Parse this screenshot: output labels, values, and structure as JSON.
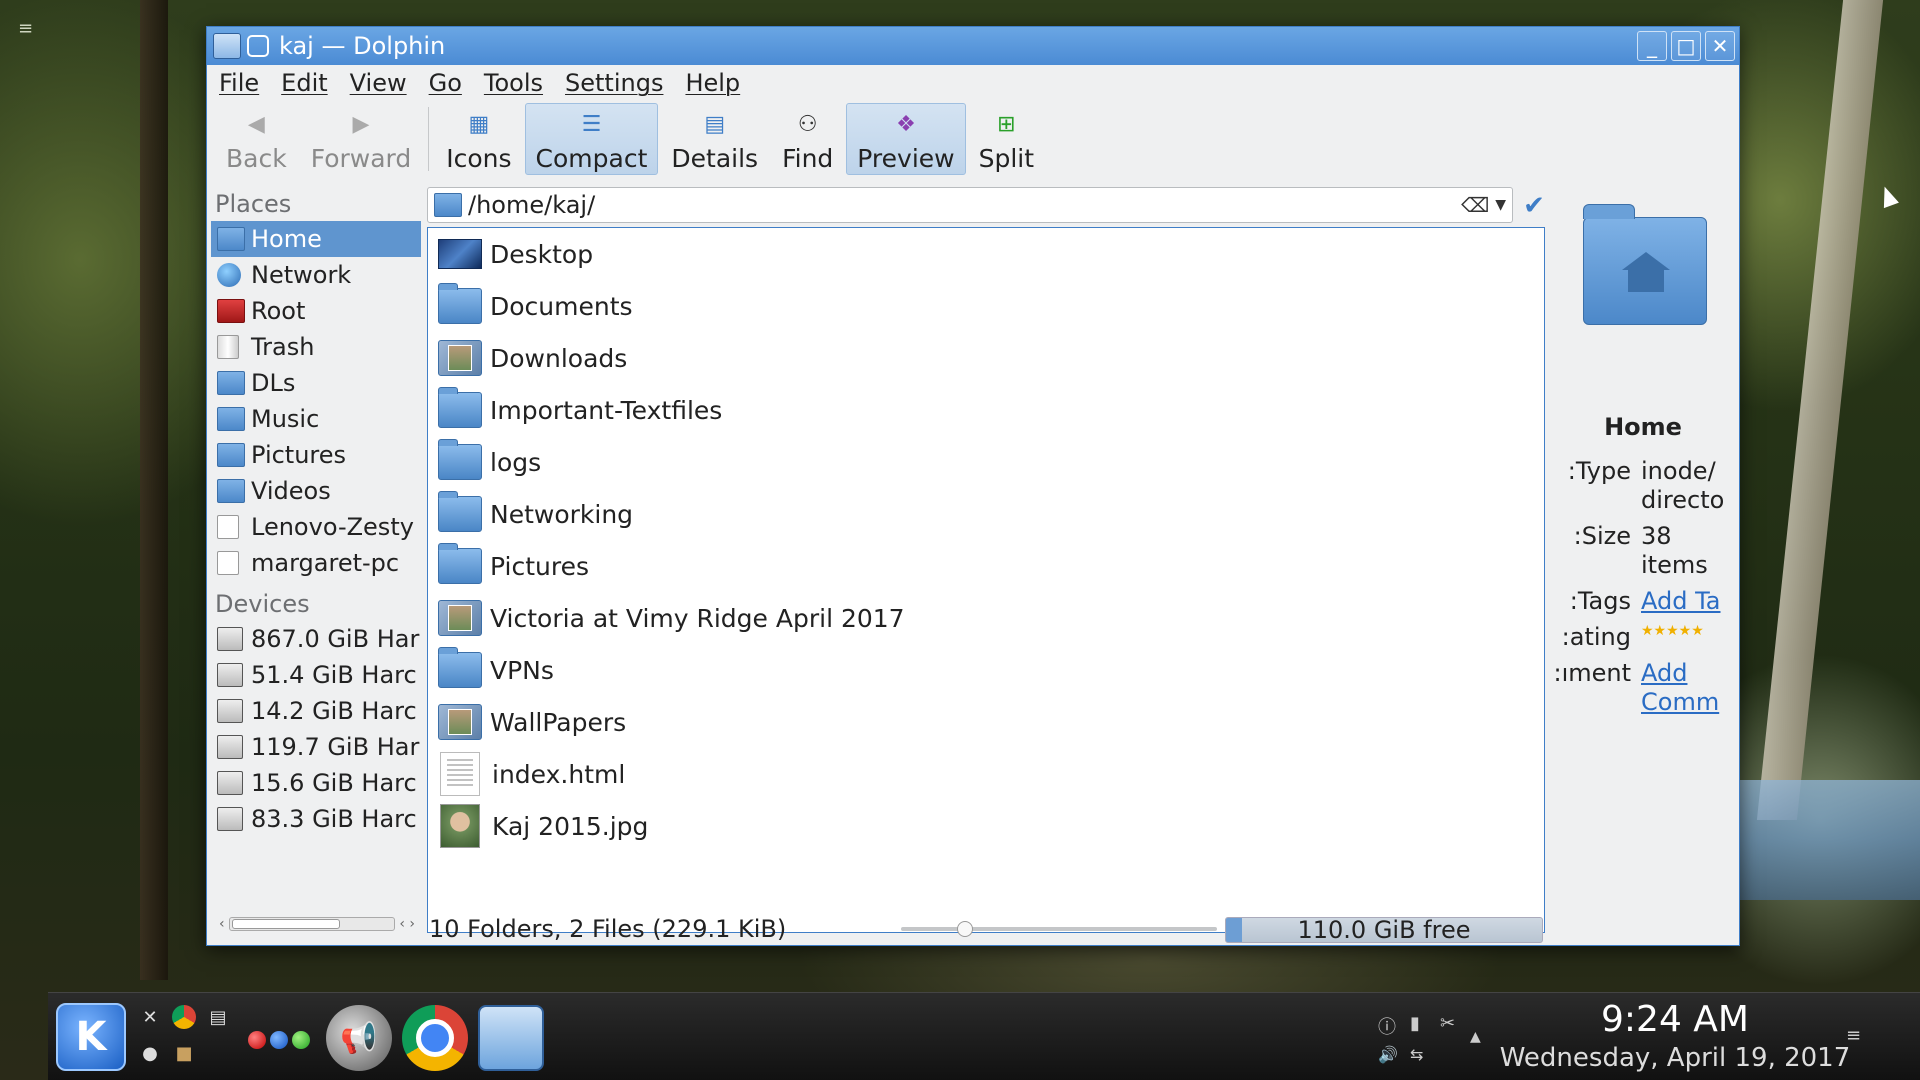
{
  "window": {
    "title": "kaj — Dolphin",
    "controls": [
      "minimize",
      "maximize",
      "close"
    ]
  },
  "menubar": [
    "File",
    "Edit",
    "View",
    "Go",
    "Tools",
    "Settings",
    "Help"
  ],
  "toolbar": {
    "back": "Back",
    "forward": "Forward",
    "icons": "Icons",
    "compact": "Compact",
    "details": "Details",
    "find": "Find",
    "preview": "Preview",
    "split": "Split"
  },
  "places": {
    "title": "Places",
    "items": [
      "Home",
      "Network",
      "Root",
      "Trash",
      "DLs",
      "Music",
      "Pictures",
      "Videos",
      "Lenovo-Zesty",
      "margaret-pc"
    ],
    "selected": "Home"
  },
  "devices": {
    "title": "Devices",
    "items": [
      "867.0 GiB Har",
      "51.4 GiB Harc",
      "14.2 GiB Harc",
      "119.7 GiB Har",
      "15.6 GiB Harc",
      "83.3 GiB Harc"
    ]
  },
  "address": {
    "path": "/home/kaj/"
  },
  "files": [
    "Desktop",
    "Documents",
    "Downloads",
    "Important-Textfiles",
    "logs",
    "Networking",
    "Pictures",
    "Victoria at Vimy Ridge April 2017",
    "VPNs",
    "WallPapers",
    "index.html",
    "Kaj 2015.jpg"
  ],
  "info": {
    "name": "Home",
    "type_label": "Type:",
    "type_value1": "inode/",
    "type_value2": "directo",
    "size_label": "Size:",
    "size_value1": "38",
    "size_value2": "items",
    "tags_label": "Tags:",
    "tags_value": "Add Ta",
    "rating_label": "ating:",
    "rating_stars": "★★★★★",
    "comment_label": "ıment:",
    "comment_value1": "Add",
    "comment_value2": "Comm"
  },
  "status": {
    "summary": "10 Folders, 2 Files (229.1 KiB)",
    "free": "110.0 GiB free",
    "used_fraction": 0.05
  },
  "taskbar": {
    "time": "9:24 AM",
    "date": "Wednesday, April 19, 2017"
  },
  "colors": {
    "accent": "#4b8bd4",
    "selection": "#5f95cf"
  }
}
